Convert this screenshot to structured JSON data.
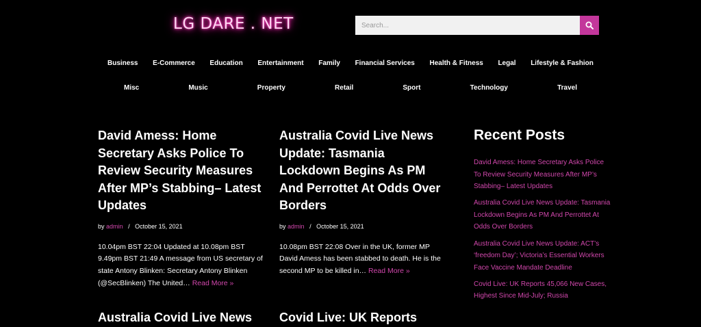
{
  "header": {
    "logo": "LG DARE . NET",
    "search": {
      "placeholder": "Search..."
    }
  },
  "nav": {
    "row1": [
      "Business",
      "E-Commerce",
      "Education",
      "Entertainment",
      "Family",
      "Financial Services",
      "Health & Fitness",
      "Legal",
      "Lifestyle & Fashion"
    ],
    "row2": [
      "Misc",
      "Music",
      "Property",
      "Retail",
      "Sport",
      "Technology",
      "Travel"
    ]
  },
  "posts": [
    {
      "title": "David Amess: Home Secretary Asks Police To Review Security Measures After MP’s Stabbing– Latest Updates",
      "by": "by",
      "author": "admin",
      "sep": "/",
      "date": "October 15, 2021",
      "excerpt": "10.04pm BST 22:04 Updated at 10.08pm BST 9.49pm BST 21:49 A message from US secretary of state Antony Blinken: Secretary Antony Blinken (@SecBlinken) The United…",
      "more": "Read More »"
    },
    {
      "title": "Australia Covid Live News Update: Tasmania Lockdown Begins As PM And Perrottet At Odds Over Borders",
      "by": "by",
      "author": "admin",
      "sep": "/",
      "date": "October 15, 2021",
      "excerpt": "10.08pm BST 22:08 Over in the UK, former MP David Amess has been stabbed to death. He is the second MP to be killed in…",
      "more": "Read More »"
    },
    {
      "title": "Australia Covid Live News"
    },
    {
      "title": "Covid Live: UK Reports"
    }
  ],
  "sidebar": {
    "title": "Recent Posts",
    "links": [
      "David Amess: Home Secretary Asks Police To Review Security Measures After MP’s Stabbing– Latest Updates",
      "Australia Covid Live News Update: Tasmania Lockdown Begins As PM And Perrottet At Odds Over Borders",
      "Australia Covid Live News Update: ACT’s ‘freedom Day’; Victoria’s Essential Workers Face Vaccine Mandate Deadline",
      "Covid Live: UK Reports 45,066 New Cases, Highest Since Mid-July; Russia"
    ]
  },
  "colors": {
    "accent": "#d147ac",
    "search_button": "#c3379b",
    "background": "#000000"
  }
}
